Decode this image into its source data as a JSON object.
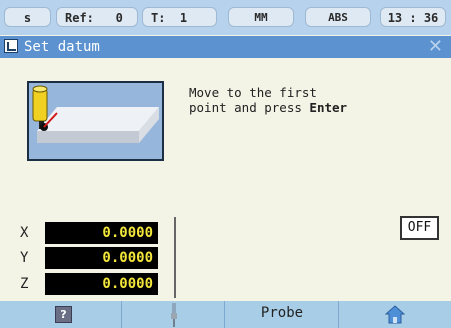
{
  "status_bar": {
    "spindle": "s",
    "ref_label": "Ref:",
    "ref_value": "0",
    "tool_label": "T:",
    "tool_value": "1",
    "units": "MM",
    "mode": "ABS",
    "clock": "13 : 36"
  },
  "dialog": {
    "title": "Set datum",
    "message_line1": "Move to the first",
    "message_line2_prefix": "point and press ",
    "message_line2_key": "Enter",
    "off_label": "OFF"
  },
  "axes": [
    {
      "label": "X",
      "value": "0.0000"
    },
    {
      "label": "Y",
      "value": "0.0000"
    },
    {
      "label": "Z",
      "value": "0.0000"
    }
  ],
  "softkeys": {
    "help_glyph": "?",
    "probe_label": "Probe"
  },
  "icons": [
    "set-datum-icon",
    "close-icon",
    "edge-finder-illustration",
    "help-icon",
    "edge-finder-icon",
    "home-icon"
  ],
  "colors": {
    "status_bar": "#b7d2ec",
    "title_bar": "#5b92cf",
    "background": "#f3f3e6",
    "axis_value_bg": "#000000",
    "axis_value_text": "#f2e63b",
    "softkey_bar": "#a8cde6"
  }
}
